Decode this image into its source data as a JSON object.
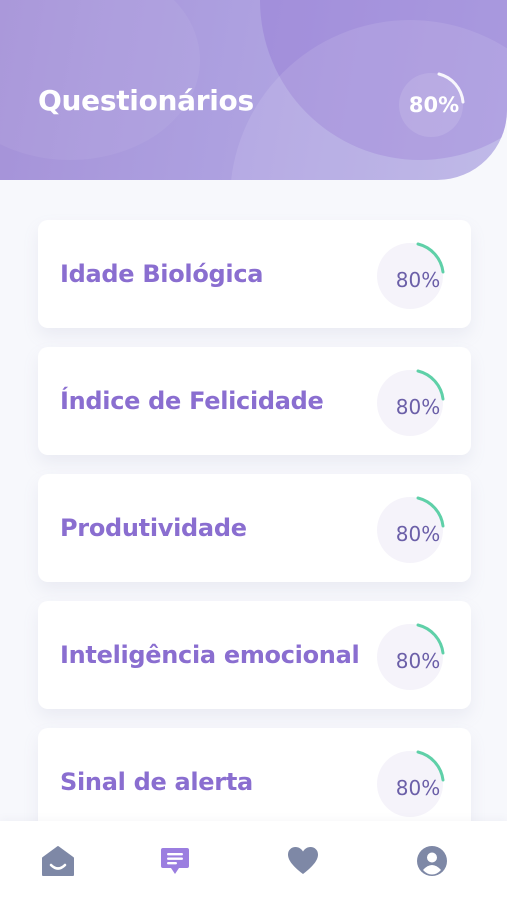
{
  "header": {
    "title": "Questionários",
    "overall_progress_label": "80%",
    "overall_progress": 0.8
  },
  "questionnaires": [
    {
      "label": "Idade Biológica",
      "progress_label": "80%",
      "progress": 0.8
    },
    {
      "label": "Índice de Felicidade",
      "progress_label": "80%",
      "progress": 0.8
    },
    {
      "label": "Produtividade",
      "progress_label": "80%",
      "progress": 0.8
    },
    {
      "label": "Inteligência emocional",
      "progress_label": "80%",
      "progress": 0.8
    },
    {
      "label": "Sinal de alerta",
      "progress_label": "80%",
      "progress": 0.8
    }
  ],
  "navbar": {
    "items": [
      {
        "icon": "home-icon",
        "active": false
      },
      {
        "icon": "chat-icon",
        "active": true
      },
      {
        "icon": "heart-icon",
        "active": false
      },
      {
        "icon": "user-icon",
        "active": false
      }
    ]
  },
  "colors": {
    "accent": "#8a6ed0",
    "progress_arc": "#5fd0a8",
    "nav_inactive": "#7e88a6",
    "nav_active": "#9b7ee0"
  }
}
